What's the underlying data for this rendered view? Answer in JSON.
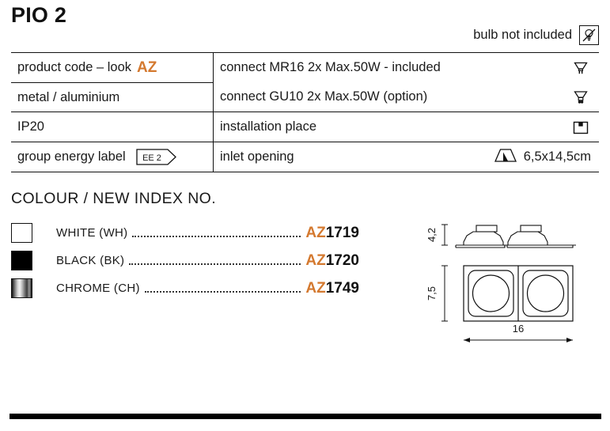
{
  "product": {
    "title": "PIO 2"
  },
  "header_note": {
    "label": "bulb not included",
    "icon": "no-bulb-icon"
  },
  "spec_table": {
    "rows": [
      {
        "left_label": "product code – look",
        "left_accent": "AZ",
        "right_label": "connect MR16 2x Max.50W - included",
        "right_icon": "mr16-bulb-icon"
      },
      {
        "left_label": "metal / aluminium",
        "right_label": "connect GU10 2x Max.50W (option)",
        "right_icon": "gu10-bulb-icon"
      },
      {
        "left_label": "IP20",
        "right_label": "installation place",
        "right_icon": "ceiling-mount-icon"
      },
      {
        "left_label": "group energy label",
        "left_badge": "EE 2",
        "right_label": "inlet opening",
        "right_icon": "inlet-opening-icon",
        "right_value": "6,5x14,5cm"
      }
    ]
  },
  "colour_section": {
    "heading": "COLOUR / NEW INDEX NO.",
    "items": [
      {
        "swatch": "white",
        "name": "WHITE (WH)",
        "prefix": "AZ",
        "number": "1719"
      },
      {
        "swatch": "black",
        "name": "BLACK (BK)",
        "prefix": "AZ",
        "number": "1720"
      },
      {
        "swatch": "chrome",
        "name": "CHROME (CH)",
        "prefix": "AZ",
        "number": "1749"
      }
    ]
  },
  "drawing": {
    "height_label": "4,2",
    "front_height_label": "7,5",
    "width_label": "16"
  },
  "colors": {
    "accent_orange": "#d4792f",
    "text": "#1a1a1a",
    "rule": "#111111"
  }
}
